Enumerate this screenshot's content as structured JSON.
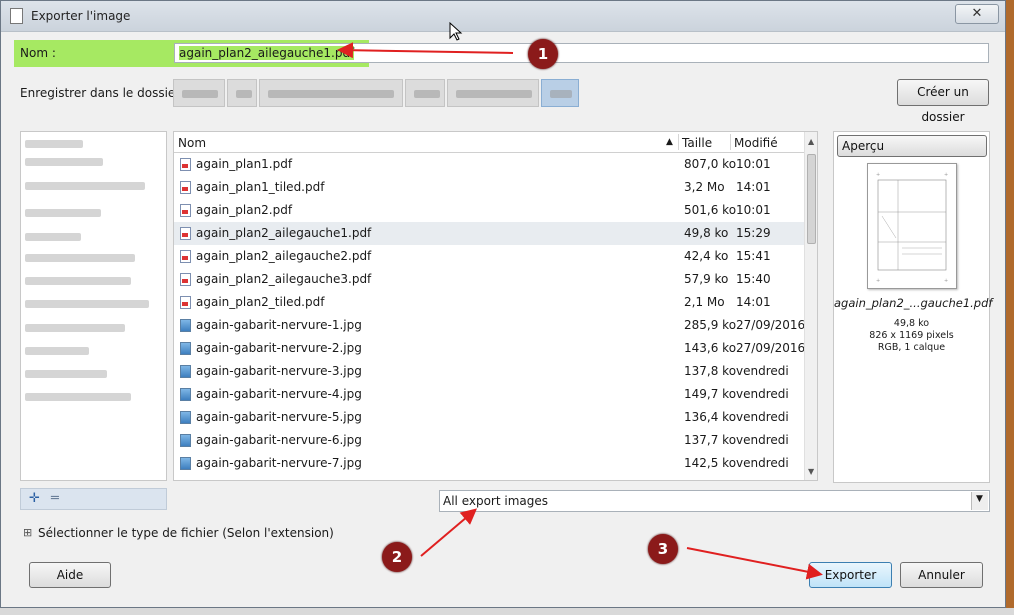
{
  "dialog": {
    "title": "Exporter l'image",
    "close_glyph": "✕"
  },
  "name_row": {
    "label": "Nom :",
    "value": "again_plan2_ailegauche1.pdf"
  },
  "folder_row": {
    "label": "Enregistrer dans le dossier :",
    "create_folder_label": "Créer un dossier"
  },
  "file_list": {
    "headers": {
      "name": "Nom",
      "size": "Taille",
      "modified": "Modifié"
    },
    "rows": [
      {
        "name": "again_plan1.pdf",
        "size": "807,0 ko",
        "modified": "10:01",
        "type": "pdf"
      },
      {
        "name": "again_plan1_tiled.pdf",
        "size": "3,2 Mo",
        "modified": "14:01",
        "type": "pdf"
      },
      {
        "name": "again_plan2.pdf",
        "size": "501,6 ko",
        "modified": "10:01",
        "type": "pdf"
      },
      {
        "name": "again_plan2_ailegauche1.pdf",
        "size": "49,8 ko",
        "modified": "15:29",
        "type": "pdf"
      },
      {
        "name": "again_plan2_ailegauche2.pdf",
        "size": "42,4 ko",
        "modified": "15:41",
        "type": "pdf"
      },
      {
        "name": "again_plan2_ailegauche3.pdf",
        "size": "57,9 ko",
        "modified": "15:40",
        "type": "pdf"
      },
      {
        "name": "again_plan2_tiled.pdf",
        "size": "2,1 Mo",
        "modified": "14:01",
        "type": "pdf"
      },
      {
        "name": "again-gabarit-nervure-1.jpg",
        "size": "285,9 ko",
        "modified": "27/09/2016",
        "type": "jpg"
      },
      {
        "name": "again-gabarit-nervure-2.jpg",
        "size": "143,6 ko",
        "modified": "27/09/2016",
        "type": "jpg"
      },
      {
        "name": "again-gabarit-nervure-3.jpg",
        "size": "137,8 ko",
        "modified": "vendredi",
        "type": "jpg"
      },
      {
        "name": "again-gabarit-nervure-4.jpg",
        "size": "149,7 ko",
        "modified": "vendredi",
        "type": "jpg"
      },
      {
        "name": "again-gabarit-nervure-5.jpg",
        "size": "136,4 ko",
        "modified": "vendredi",
        "type": "jpg"
      },
      {
        "name": "again-gabarit-nervure-6.jpg",
        "size": "137,7 ko",
        "modified": "vendredi",
        "type": "jpg"
      },
      {
        "name": "again-gabarit-nervure-7.jpg",
        "size": "142,5 ko",
        "modified": "vendredi",
        "type": "jpg"
      }
    ]
  },
  "preview": {
    "title": "Aperçu",
    "filename": "again_plan2_...gauche1.pdf",
    "size": "49,8 ko",
    "dimensions": "826 x 1169 pixels",
    "mode": "RGB, 1 calque"
  },
  "filter": {
    "selected": "All export images"
  },
  "filetype_toggle": {
    "label": "Sélectionner le type de fichier (Selon l'extension)",
    "glyph": "⊞"
  },
  "buttons": {
    "help": "Aide",
    "export": "Exporter",
    "cancel": "Annuler"
  },
  "annotations": [
    "1",
    "2",
    "3"
  ],
  "colors": {
    "highlight": "#a6e962",
    "arrow": "#e02020",
    "badge": "#8b1a1a"
  }
}
